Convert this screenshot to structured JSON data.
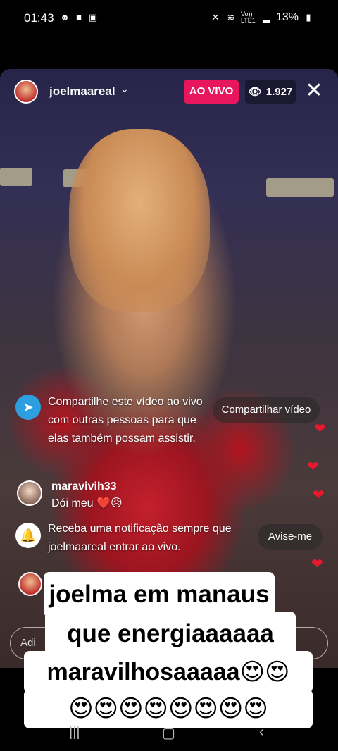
{
  "status_bar": {
    "time": "01:43",
    "left_icons": [
      "smiley-icon",
      "video-icon",
      "instagram-icon"
    ],
    "battery": "13%",
    "volte_label": "Vo)) LTE1"
  },
  "live": {
    "host_name": "joelmaareal",
    "live_badge": "AO VIVO",
    "viewer_count": "1.927"
  },
  "share_prompt": {
    "text": "Compartilhe este vídeo ao vivo com outras pessoas para que elas também possam assistir.",
    "button": "Compartilhar vídeo"
  },
  "comment": {
    "username": "maravivih33",
    "text": "Dói meu ❤️😥"
  },
  "notify_prompt": {
    "text": "Receba uma notificação sempre que joelmaareal entrar ao vivo.",
    "button": "Avise-me"
  },
  "comment_input": {
    "placeholder": "Adi"
  },
  "caption": {
    "line1": "joelma em manaus",
    "line2": "que energiaaaaaa",
    "line3": "maravilhosaaaaa😍😍",
    "line4": "😍😍😍😍😍😍😍😍"
  },
  "colors": {
    "live_badge": "#e8165c",
    "heart": "#e8182e"
  }
}
